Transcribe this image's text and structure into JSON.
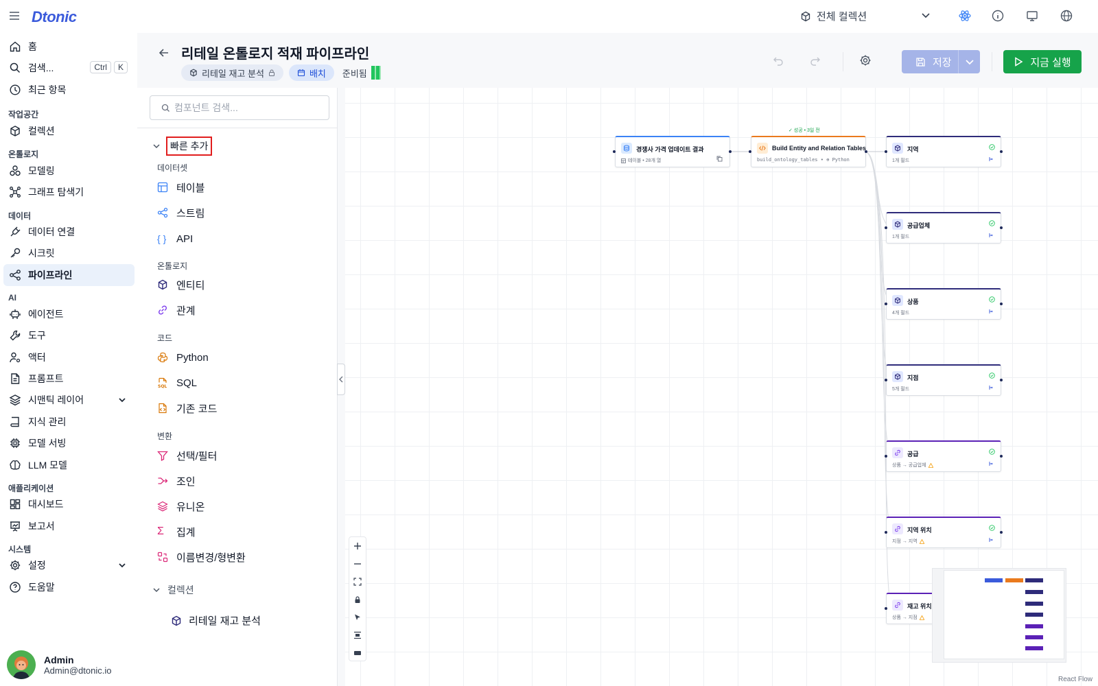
{
  "app": {
    "logo": "Dtonic",
    "collection_selector": "전체 컬렉션"
  },
  "sidebar": {
    "home": "홈",
    "search": "검색...",
    "search_kbd1": "Ctrl",
    "search_kbd2": "K",
    "recent": "최근 항목",
    "workspace_label": "작업공간",
    "collection": "컬렉션",
    "ontology_label": "온톨로지",
    "modeling": "모델링",
    "graph_explorer": "그래프 탐색기",
    "data_label": "데이터",
    "data_connection": "데이터 연결",
    "secret": "시크릿",
    "pipeline": "파이프라인",
    "ai_label": "AI",
    "agent": "에이전트",
    "tool": "도구",
    "actor": "액터",
    "prompt": "프롬프트",
    "semantic_layer": "시맨틱 레이어",
    "knowledge": "지식 관리",
    "model_serving": "모델 서빙",
    "llm_model": "LLM 모델",
    "apps_label": "애플리케이션",
    "dashboard": "대시보드",
    "report": "보고서",
    "system_label": "시스템",
    "settings": "설정",
    "help": "도움말"
  },
  "user": {
    "name": "Admin",
    "email": "Admin@dtonic.io"
  },
  "header": {
    "title": "리테일 온톨로지 적재 파이프라인",
    "chip_collection": "리테일 재고 분석",
    "chip_batch": "배치",
    "status": "준비됨",
    "save": "저장",
    "run": "지금 실행"
  },
  "panel": {
    "search_placeholder": "컴포넌트 검색...",
    "quick_add": "빠른 추가",
    "dataset_label": "데이터셋",
    "table": "테이블",
    "stream": "스트림",
    "api": "API",
    "ontology_label": "온톨로지",
    "entity": "엔티티",
    "relation": "관계",
    "code_label": "코드",
    "python": "Python",
    "sql": "SQL",
    "legacy": "기존 코드",
    "transform_label": "변환",
    "select": "선택/필터",
    "join": "조인",
    "union": "유니온",
    "aggregate": "집계",
    "rename": "이름변경/형변환",
    "collections_label": "컬렉션",
    "collection_item": "리테일 재고 분석"
  },
  "canvas": {
    "src_title": "경쟁사 가격 업데이트 결과",
    "src_sub": "테이블 • 28개 열",
    "py_title": "Build Entity and Relation Tables",
    "py_sub": "build_ontology_tables • ⊕ Python",
    "py_run": "✓ 성공 • 3일 전",
    "n1_title": "지역",
    "n1_sub": "1개 필드",
    "n2_title": "공급업체",
    "n2_sub": "1개 필드",
    "n3_title": "상품",
    "n3_sub": "4개 필드",
    "n4_title": "지점",
    "n4_sub": "5개 필드",
    "n5_title": "공급",
    "n5_sub": "상품 → 공급업체",
    "n6_title": "지역 위치",
    "n6_sub": "지점 → 지역",
    "n7_title": "재고 위치",
    "n7_sub": "상품 → 지점",
    "react_flow": "React Flow"
  },
  "colors": {
    "accent": "#3b5bdb",
    "run_green": "#16a34a",
    "save_disabled": "#a5b4e8",
    "highlight": "#e11d1d",
    "entity": "#2e2b7a",
    "relation": "#5b21b6",
    "python": "#ea7a1d"
  }
}
